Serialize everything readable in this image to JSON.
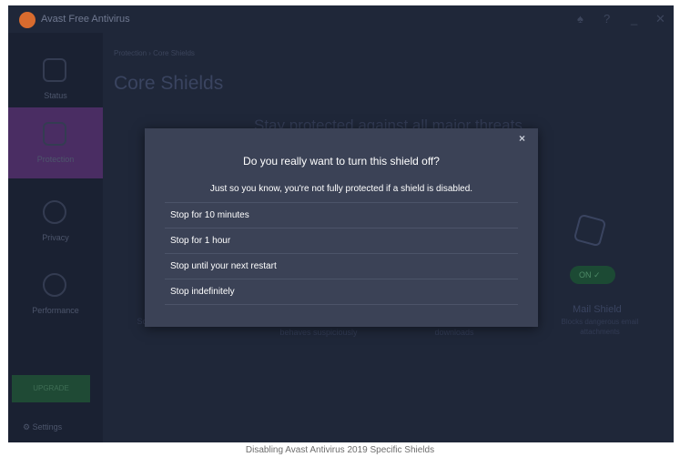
{
  "app": {
    "title": "Avast Free Antivirus"
  },
  "titlebar_icons": [
    "bell-icon",
    "help-icon",
    "minimize-icon",
    "close-icon"
  ],
  "sidebar": {
    "items": [
      {
        "label": "Status",
        "icon": "shield-check-icon"
      },
      {
        "label": "Protection",
        "icon": "lock-icon"
      },
      {
        "label": "Privacy",
        "icon": "fingerprint-icon"
      },
      {
        "label": "Performance",
        "icon": "gauge-icon"
      }
    ],
    "upgrade_label": "UPGRADE",
    "settings_label": "Settings"
  },
  "main": {
    "breadcrumb": "Protection › Core Shields",
    "title": "Core Shields",
    "subtitle": "Stay protected against all major threats",
    "col1_text": "Scans ... opened on your PC",
    "col2_text": "behaves suspiciously",
    "col3_text": "downloads",
    "mail_shield": {
      "title": "Mail Shield",
      "desc": "Blocks dangerous email attachments",
      "toggle": "ON"
    }
  },
  "modal": {
    "close": "×",
    "title": "Do you really want to turn this shield off?",
    "message": "Just so you know, you're not fully protected if a shield is disabled.",
    "options": [
      "Stop for 10 minutes",
      "Stop for 1 hour",
      "Stop until your next restart",
      "Stop indefinitely"
    ]
  },
  "caption": "Disabling Avast Antivirus 2019 Specific Shields",
  "colors": {
    "background": "#1f2739",
    "modal": "#3b4256",
    "accent": "#4a2d63"
  }
}
